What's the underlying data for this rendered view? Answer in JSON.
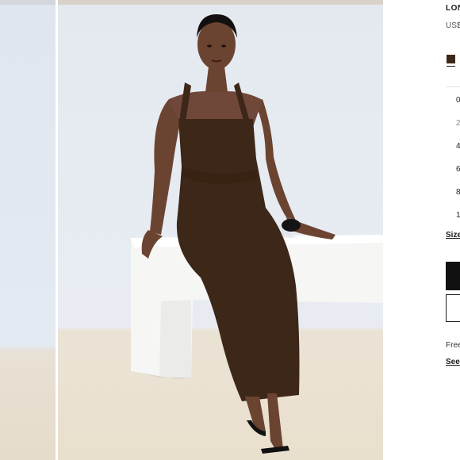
{
  "product": {
    "title": "LON",
    "price": "US$",
    "color": {
      "hex": "#3d2718",
      "icon": "color-swatch"
    }
  },
  "sizes": [
    "0",
    "2",
    "4",
    "6",
    "8",
    "1"
  ],
  "size_guide": "Size",
  "shipping": {
    "text": "Free",
    "link": "See"
  }
}
